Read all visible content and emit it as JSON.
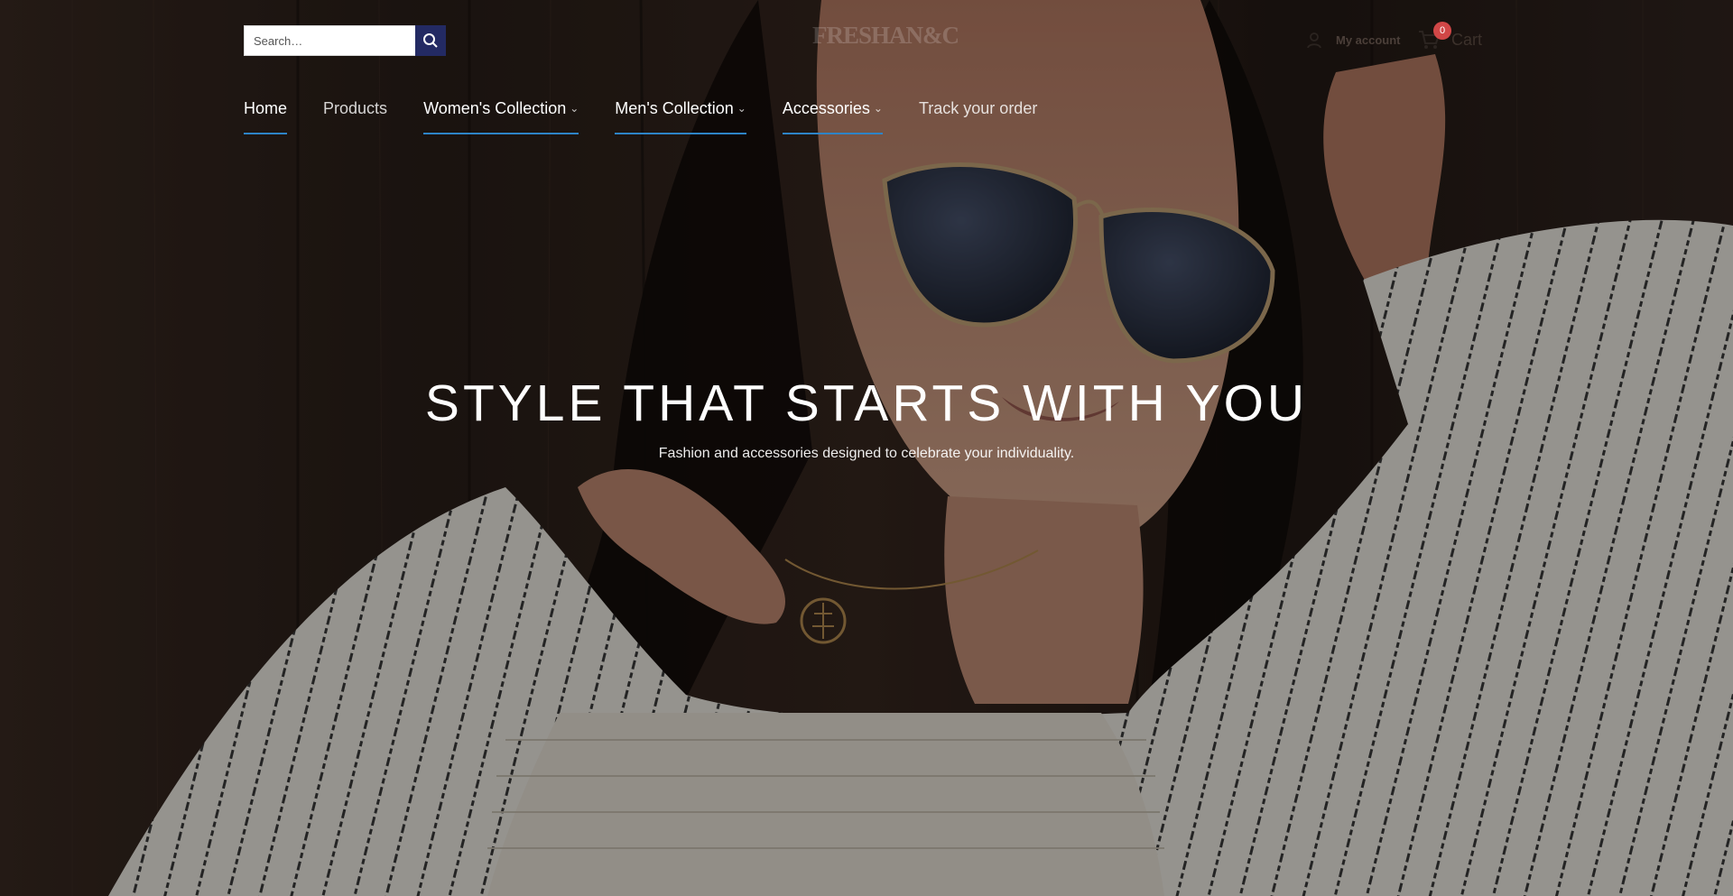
{
  "header": {
    "search_placeholder": "Search…",
    "logo_text": "FRESHAN&C",
    "account_label": "My account",
    "cart_label": "Cart",
    "cart_count": "0"
  },
  "nav": [
    {
      "label": "Home"
    },
    {
      "label": "Products"
    },
    {
      "label": "Women's Collection"
    },
    {
      "label": "Men's Collection"
    },
    {
      "label": "Accessories"
    },
    {
      "label": "Track your order"
    }
  ],
  "hero": {
    "title": "STYLE THAT STARTS WITH YOU",
    "subtitle": "Fashion and accessories designed to celebrate your individuality."
  },
  "colors": {
    "nav_underline": "#2d84c7",
    "search_button": "#232a63",
    "cart_badge": "#d04747"
  },
  "icons": [
    "search-icon",
    "user-icon",
    "cart-icon",
    "chevron-down-icon"
  ]
}
